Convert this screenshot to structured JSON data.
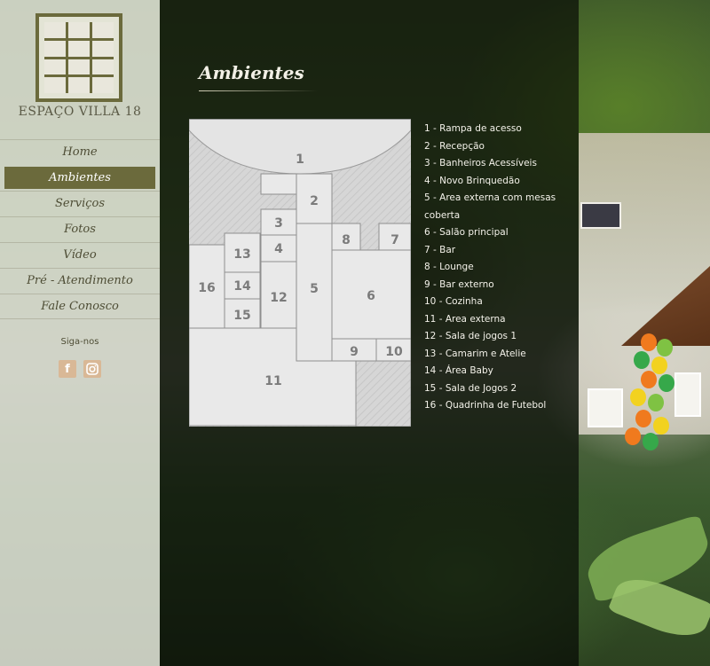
{
  "brand": {
    "name": "Espaço Villa 18",
    "logo_text": "ESPAÇO VILLA 18"
  },
  "nav": {
    "items": [
      {
        "label": "Home",
        "active": false
      },
      {
        "label": "Ambientes",
        "active": true
      },
      {
        "label": "Serviços",
        "active": false
      },
      {
        "label": "Fotos",
        "active": false
      },
      {
        "label": "Vídeo",
        "active": false
      },
      {
        "label": "Pré - Atendimento",
        "active": false
      },
      {
        "label": "Fale Conosco",
        "active": false
      }
    ]
  },
  "social": {
    "title": "Siga-nos",
    "icons": [
      {
        "icon": "facebook-icon",
        "glyph": "f",
        "color": "#d9b896"
      },
      {
        "icon": "instagram-icon",
        "glyph": "◘",
        "color": "#d9b896"
      }
    ]
  },
  "page": {
    "title": "Ambientes"
  },
  "floorplan": {
    "rooms": [
      {
        "label": "1"
      },
      {
        "label": "2"
      },
      {
        "label": "3"
      },
      {
        "label": "4"
      },
      {
        "label": "5"
      },
      {
        "label": "6"
      },
      {
        "label": "7"
      },
      {
        "label": "8"
      },
      {
        "label": "9"
      },
      {
        "label": "10"
      },
      {
        "label": "11"
      },
      {
        "label": "12"
      },
      {
        "label": "13"
      },
      {
        "label": "14"
      },
      {
        "label": "15"
      },
      {
        "label": "16"
      }
    ]
  },
  "legend": [
    "1 - Rampa de acesso",
    "2 - Recepção",
    "3 - Banheiros Acessíveis",
    "4 - Novo Brinquedão",
    "5 - Area externa com mesas coberta",
    "6 - Salão principal",
    "7 - Bar",
    "8 - Lounge",
    "9 - Bar externo",
    "10 - Cozinha",
    "11 - Area externa",
    "12 - Sala de jogos 1",
    "13 - Camarim e Atelie",
    "14 - Área Baby",
    "15 - Sala de Jogos 2",
    "16 - Quadrinha de Futebol"
  ],
  "colors": {
    "accent": "#6b6a3c",
    "sidebar_bg": "#eeeee6",
    "plan_fill": "#e8e8e8",
    "plan_stroke": "#8c8c8c",
    "plan_text": "#7b7b7b"
  }
}
